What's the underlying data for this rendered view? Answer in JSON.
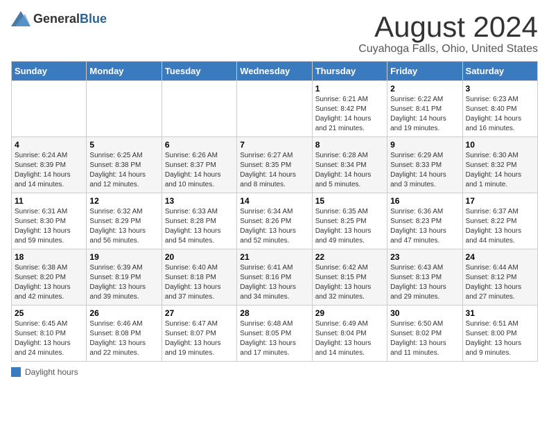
{
  "header": {
    "logo_general": "General",
    "logo_blue": "Blue",
    "month_title": "August 2024",
    "location": "Cuyahoga Falls, Ohio, United States"
  },
  "days_of_week": [
    "Sunday",
    "Monday",
    "Tuesday",
    "Wednesday",
    "Thursday",
    "Friday",
    "Saturday"
  ],
  "weeks": [
    [
      {
        "day": "",
        "info": ""
      },
      {
        "day": "",
        "info": ""
      },
      {
        "day": "",
        "info": ""
      },
      {
        "day": "",
        "info": ""
      },
      {
        "day": "1",
        "info": "Sunrise: 6:21 AM\nSunset: 8:42 PM\nDaylight: 14 hours\nand 21 minutes."
      },
      {
        "day": "2",
        "info": "Sunrise: 6:22 AM\nSunset: 8:41 PM\nDaylight: 14 hours\nand 19 minutes."
      },
      {
        "day": "3",
        "info": "Sunrise: 6:23 AM\nSunset: 8:40 PM\nDaylight: 14 hours\nand 16 minutes."
      }
    ],
    [
      {
        "day": "4",
        "info": "Sunrise: 6:24 AM\nSunset: 8:39 PM\nDaylight: 14 hours\nand 14 minutes."
      },
      {
        "day": "5",
        "info": "Sunrise: 6:25 AM\nSunset: 8:38 PM\nDaylight: 14 hours\nand 12 minutes."
      },
      {
        "day": "6",
        "info": "Sunrise: 6:26 AM\nSunset: 8:37 PM\nDaylight: 14 hours\nand 10 minutes."
      },
      {
        "day": "7",
        "info": "Sunrise: 6:27 AM\nSunset: 8:35 PM\nDaylight: 14 hours\nand 8 minutes."
      },
      {
        "day": "8",
        "info": "Sunrise: 6:28 AM\nSunset: 8:34 PM\nDaylight: 14 hours\nand 5 minutes."
      },
      {
        "day": "9",
        "info": "Sunrise: 6:29 AM\nSunset: 8:33 PM\nDaylight: 14 hours\nand 3 minutes."
      },
      {
        "day": "10",
        "info": "Sunrise: 6:30 AM\nSunset: 8:32 PM\nDaylight: 14 hours\nand 1 minute."
      }
    ],
    [
      {
        "day": "11",
        "info": "Sunrise: 6:31 AM\nSunset: 8:30 PM\nDaylight: 13 hours\nand 59 minutes."
      },
      {
        "day": "12",
        "info": "Sunrise: 6:32 AM\nSunset: 8:29 PM\nDaylight: 13 hours\nand 56 minutes."
      },
      {
        "day": "13",
        "info": "Sunrise: 6:33 AM\nSunset: 8:28 PM\nDaylight: 13 hours\nand 54 minutes."
      },
      {
        "day": "14",
        "info": "Sunrise: 6:34 AM\nSunset: 8:26 PM\nDaylight: 13 hours\nand 52 minutes."
      },
      {
        "day": "15",
        "info": "Sunrise: 6:35 AM\nSunset: 8:25 PM\nDaylight: 13 hours\nand 49 minutes."
      },
      {
        "day": "16",
        "info": "Sunrise: 6:36 AM\nSunset: 8:23 PM\nDaylight: 13 hours\nand 47 minutes."
      },
      {
        "day": "17",
        "info": "Sunrise: 6:37 AM\nSunset: 8:22 PM\nDaylight: 13 hours\nand 44 minutes."
      }
    ],
    [
      {
        "day": "18",
        "info": "Sunrise: 6:38 AM\nSunset: 8:20 PM\nDaylight: 13 hours\nand 42 minutes."
      },
      {
        "day": "19",
        "info": "Sunrise: 6:39 AM\nSunset: 8:19 PM\nDaylight: 13 hours\nand 39 minutes."
      },
      {
        "day": "20",
        "info": "Sunrise: 6:40 AM\nSunset: 8:18 PM\nDaylight: 13 hours\nand 37 minutes."
      },
      {
        "day": "21",
        "info": "Sunrise: 6:41 AM\nSunset: 8:16 PM\nDaylight: 13 hours\nand 34 minutes."
      },
      {
        "day": "22",
        "info": "Sunrise: 6:42 AM\nSunset: 8:15 PM\nDaylight: 13 hours\nand 32 minutes."
      },
      {
        "day": "23",
        "info": "Sunrise: 6:43 AM\nSunset: 8:13 PM\nDaylight: 13 hours\nand 29 minutes."
      },
      {
        "day": "24",
        "info": "Sunrise: 6:44 AM\nSunset: 8:12 PM\nDaylight: 13 hours\nand 27 minutes."
      }
    ],
    [
      {
        "day": "25",
        "info": "Sunrise: 6:45 AM\nSunset: 8:10 PM\nDaylight: 13 hours\nand 24 minutes."
      },
      {
        "day": "26",
        "info": "Sunrise: 6:46 AM\nSunset: 8:08 PM\nDaylight: 13 hours\nand 22 minutes."
      },
      {
        "day": "27",
        "info": "Sunrise: 6:47 AM\nSunset: 8:07 PM\nDaylight: 13 hours\nand 19 minutes."
      },
      {
        "day": "28",
        "info": "Sunrise: 6:48 AM\nSunset: 8:05 PM\nDaylight: 13 hours\nand 17 minutes."
      },
      {
        "day": "29",
        "info": "Sunrise: 6:49 AM\nSunset: 8:04 PM\nDaylight: 13 hours\nand 14 minutes."
      },
      {
        "day": "30",
        "info": "Sunrise: 6:50 AM\nSunset: 8:02 PM\nDaylight: 13 hours\nand 11 minutes."
      },
      {
        "day": "31",
        "info": "Sunrise: 6:51 AM\nSunset: 8:00 PM\nDaylight: 13 hours\nand 9 minutes."
      }
    ]
  ],
  "legend": {
    "box_color": "#3a7abf",
    "label": "Daylight hours"
  }
}
